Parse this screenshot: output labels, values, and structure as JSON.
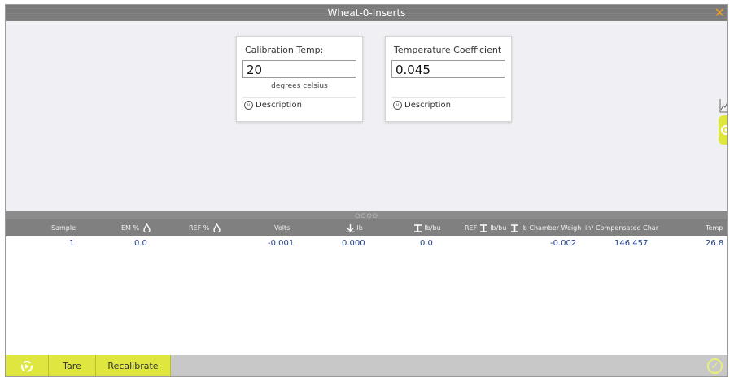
{
  "window": {
    "title": "Wheat-0-Inserts",
    "close_glyph": "✕"
  },
  "cards": [
    {
      "label": "Calibration Temp:",
      "value": "20",
      "unit": "degrees celsius",
      "description_label": "Description"
    },
    {
      "label": "Temperature Coefficient",
      "value": "0.045",
      "description_label": "Description"
    }
  ],
  "grid": {
    "divider_dots": "○○○○",
    "columns": [
      "Sample",
      "EM %",
      "REF %",
      "Volts",
      "lb",
      "lb/bu",
      "REF",
      "lb/bu",
      "lb Chamber Weigh",
      "in³ Compensated Char",
      "Temp"
    ],
    "rows": [
      {
        "sample": "1",
        "em": "0.0",
        "volts": "-0.001",
        "lb": "0.000",
        "lbbu": "0.0",
        "chamber": "-0.002",
        "compensated": "146.457",
        "temp": "26.8"
      }
    ]
  },
  "toolbar": {
    "tare_label": "Tare",
    "recalibrate_label": "Recalibrate"
  },
  "colors": {
    "accent": "#dfe640",
    "close": "#f0a020",
    "header": "#808080",
    "data_text": "#1f3e8a"
  }
}
